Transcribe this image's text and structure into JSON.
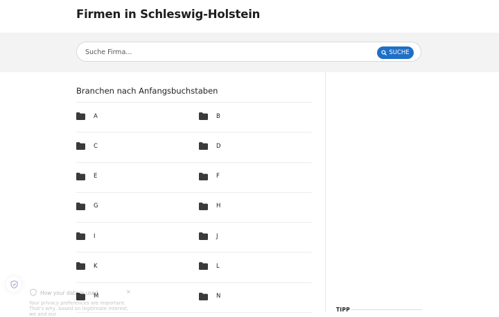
{
  "header": {
    "title": "Firmen in Schleswig-Holstein"
  },
  "search": {
    "placeholder": "Suche Firma...",
    "button_label": "SUCHE"
  },
  "categories": {
    "heading": "Branchen nach Anfangsbuchstaben",
    "letters": [
      "A",
      "B",
      "C",
      "D",
      "E",
      "F",
      "G",
      "H",
      "I",
      "J",
      "K",
      "L",
      "M",
      "N"
    ]
  },
  "sidebar": {
    "tipp_label": "TIPP"
  },
  "privacy": {
    "heading": "How your data is used",
    "text": "Your privacy preferences are important. That's why, based on legitimate interest, we and our",
    "close": "×"
  }
}
